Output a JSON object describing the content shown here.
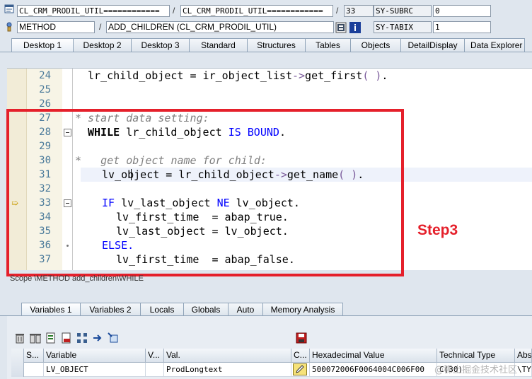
{
  "header": {
    "row1": {
      "field1": "CL_CRM_PRODIL_UTIL============",
      "field2": "CL_CRM_PRODIL_UTIL============",
      "field3": "33",
      "sysvar": "SY-SUBRC",
      "sysval": "0"
    },
    "row2": {
      "type": "METHOD",
      "method": "ADD_CHILDREN (CL_CRM_PRODIL_UTIL)",
      "sysvar": "SY-TABIX",
      "sysval": "1"
    },
    "separator": "/"
  },
  "desktop_tabs": [
    {
      "label": "Desktop 1",
      "active": true
    },
    {
      "label": "Desktop 2"
    },
    {
      "label": "Desktop 3"
    },
    {
      "label": "Standard"
    },
    {
      "label": "Structures"
    },
    {
      "label": "Tables"
    },
    {
      "label": "Objects"
    },
    {
      "label": "DetailDisplay"
    },
    {
      "label": "Data Explorer"
    }
  ],
  "code_lines": [
    {
      "num": "24",
      "code": "lr_child_object = ir_object_list->get_first( )."
    },
    {
      "num": "25",
      "code": ""
    },
    {
      "num": "26",
      "code": ""
    },
    {
      "num": "27",
      "code": "* start data setting:"
    },
    {
      "num": "28",
      "code": "WHILE lr_child_object IS BOUND."
    },
    {
      "num": "29",
      "code": ""
    },
    {
      "num": "30",
      "code": "*   get object name for child:"
    },
    {
      "num": "31",
      "code": "lv_object = lr_child_object->get_name( )."
    },
    {
      "num": "32",
      "code": ""
    },
    {
      "num": "33",
      "code": "IF lv_last_object NE lv_object."
    },
    {
      "num": "34",
      "code": "lv_first_time  = abap_true."
    },
    {
      "num": "35",
      "code": "lv_last_object = lv_object."
    },
    {
      "num": "36",
      "code": "ELSE."
    },
    {
      "num": "37",
      "code": "lv_first_time  = abap_false."
    }
  ],
  "annotation": "Step3",
  "scope": "Scope \\METHOD add_children\\WHILE",
  "variable_tabs": [
    {
      "label": "Variables 1",
      "active": true
    },
    {
      "label": "Variables 2"
    },
    {
      "label": "Locals"
    },
    {
      "label": "Globals"
    },
    {
      "label": "Auto"
    },
    {
      "label": "Memory Analysis"
    }
  ],
  "grid": {
    "columns": [
      "S...",
      "Variable",
      "V...",
      "Val.",
      "C...",
      "Hexadecimal Value",
      "Technical Type",
      "Abso"
    ],
    "row": {
      "variable": "LV_OBJECT",
      "value": "ProdLongtext",
      "hex": "500072006F0064004C006F00",
      "type": "C(30)",
      "abs": "\\TYPE"
    }
  },
  "watermark": "@稀土掘金技术社区",
  "colors": {
    "annotation": "#e5202b",
    "keyword": "#0000ff",
    "comment": "#808080"
  }
}
